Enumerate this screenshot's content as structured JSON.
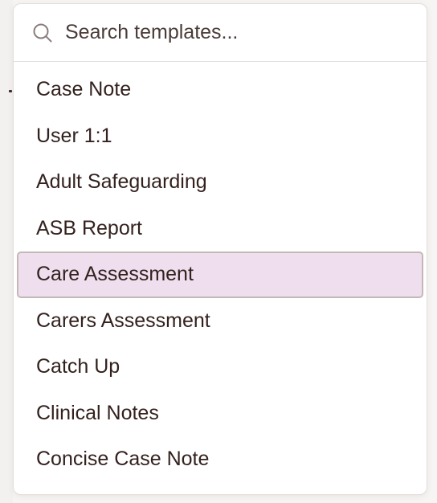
{
  "search": {
    "placeholder": "Search templates..."
  },
  "icons": {
    "search": "search-icon"
  },
  "colors": {
    "selected_background": "#efdfee",
    "selected_border": "#c4b8b6",
    "text": "#33211e"
  },
  "templates": [
    {
      "label": "Case Note",
      "selected": false
    },
    {
      "label": "User 1:1",
      "selected": false
    },
    {
      "label": "Adult Safeguarding",
      "selected": false
    },
    {
      "label": "ASB Report",
      "selected": false
    },
    {
      "label": "Care Assessment",
      "selected": true
    },
    {
      "label": "Carers Assessment",
      "selected": false
    },
    {
      "label": "Catch Up",
      "selected": false
    },
    {
      "label": "Clinical Notes",
      "selected": false
    },
    {
      "label": "Concise Case Note",
      "selected": false
    }
  ]
}
